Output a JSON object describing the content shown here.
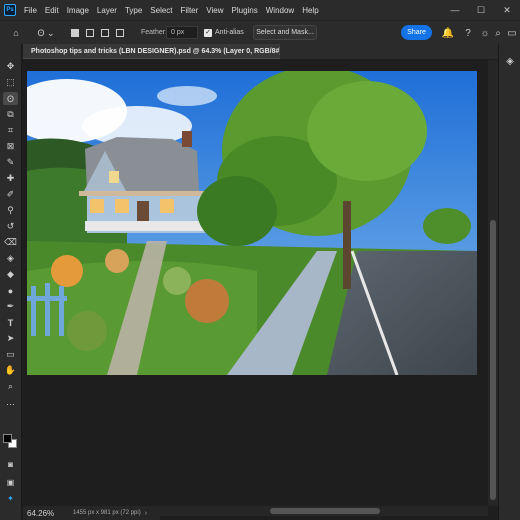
{
  "app": {
    "logo": "Ps"
  },
  "menu": [
    "File",
    "Edit",
    "Image",
    "Layer",
    "Type",
    "Select",
    "Filter",
    "View",
    "Plugins",
    "Window",
    "Help"
  ],
  "window_controls": {
    "minimize": "—",
    "maximize": "☐",
    "close": "✕"
  },
  "options_bar": {
    "home_icon": "⌂",
    "lasso_icon": "ʘ ⌄",
    "feather_label": "Feather:",
    "feather_value": "0 px",
    "antialias_label": "Anti-alias",
    "antialias_checked": "✓",
    "select_mask_label": "Select and Mask...",
    "share_label": "Share",
    "bell_icon": "🔔",
    "help_icon": "?",
    "lightbulb_icon": "☼",
    "search_icon": "⌕",
    "panels_icon": "▭",
    "chevron_icon": "⌄"
  },
  "document": {
    "tab_title": "Photoshop tips and tricks (LBN DESIGNER).psd @ 64.3% (Layer 0, RGB/8#) *"
  },
  "status": {
    "zoom": "64.26%",
    "doc_info": "1455 px x 981 px (72 ppi)",
    "arrow": "›"
  },
  "tools": [
    {
      "name": "move-tool",
      "icon": "✥"
    },
    {
      "name": "marquee-tool",
      "icon": "⬚"
    },
    {
      "name": "lasso-tool",
      "icon": "ʘ"
    },
    {
      "name": "object-select-tool",
      "icon": "⧉"
    },
    {
      "name": "crop-tool",
      "icon": "⌗"
    },
    {
      "name": "frame-tool",
      "icon": "⊠"
    },
    {
      "name": "eyedropper-tool",
      "icon": "✎"
    },
    {
      "name": "healing-tool",
      "icon": "✚"
    },
    {
      "name": "brush-tool",
      "icon": "✐"
    },
    {
      "name": "stamp-tool",
      "icon": "⚲"
    },
    {
      "name": "history-brush-tool",
      "icon": "↺"
    },
    {
      "name": "eraser-tool",
      "icon": "⌫"
    },
    {
      "name": "paint-bucket-tool",
      "icon": "◈"
    },
    {
      "name": "blur-tool",
      "icon": "◆"
    },
    {
      "name": "dodge-tool",
      "icon": "●"
    },
    {
      "name": "pen-tool",
      "icon": "✒"
    },
    {
      "name": "type-tool",
      "icon": "T"
    },
    {
      "name": "path-select-tool",
      "icon": "➤"
    },
    {
      "name": "rectangle-tool",
      "icon": "▭"
    },
    {
      "name": "hand-tool",
      "icon": "✋"
    },
    {
      "name": "zoom-tool",
      "icon": "⌕"
    },
    {
      "name": "more-tools",
      "icon": "⋯"
    }
  ],
  "colors": {
    "accent": "#1473e6",
    "foreground": "#000000",
    "background": "#ffffff"
  }
}
